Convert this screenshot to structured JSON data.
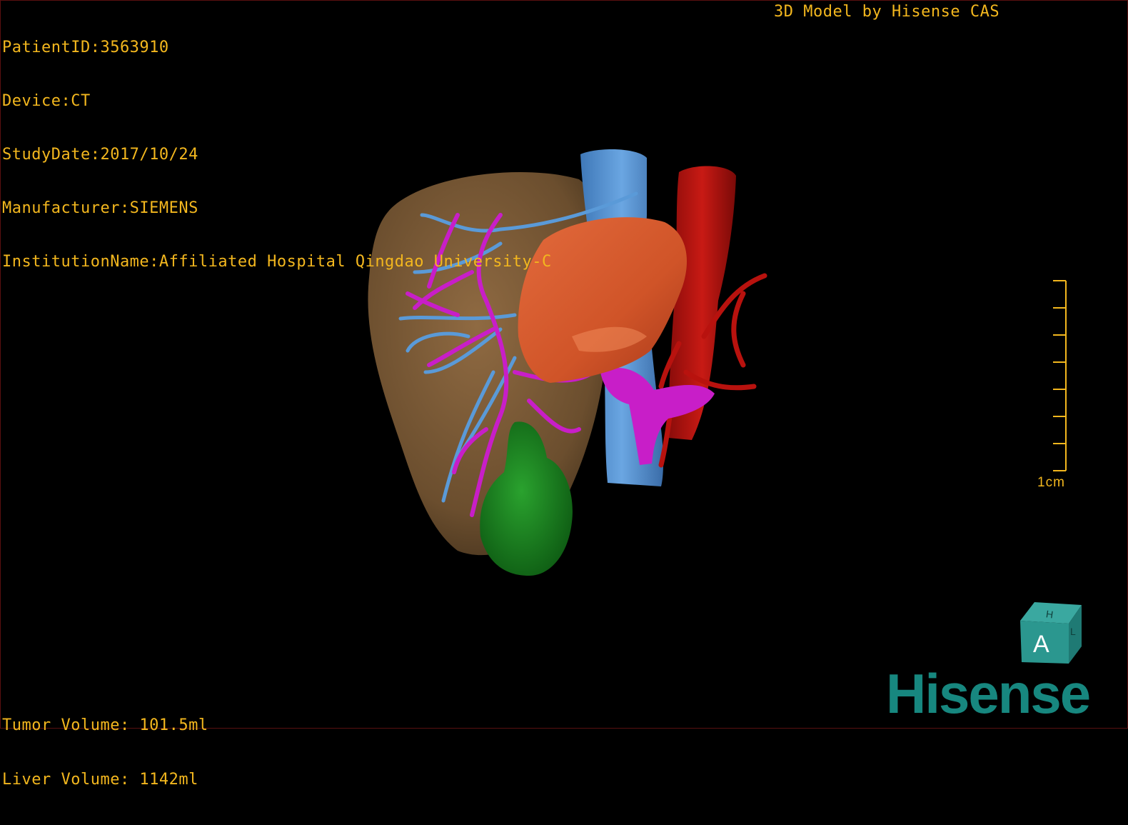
{
  "header": {
    "patient_id": "PatientID:3563910",
    "device": "Device:CT",
    "study_date": "StudyDate:2017/10/24",
    "manufacturer": "Manufacturer:SIEMENS",
    "institution": "InstitutionName:Affiliated Hospital Qingdao University-C"
  },
  "brand_caption": "3D Model by Hisense CAS",
  "volumes": {
    "tumor": "Tumor Volume: 101.5ml",
    "liver": "Liver Volume: 1142ml"
  },
  "scale": {
    "label": "1cm"
  },
  "orientation_cube": {
    "face_front": "A",
    "face_top": "H",
    "face_side": "L",
    "icon": "orientation-cube-icon"
  },
  "logo": {
    "text": "Hisense"
  },
  "colors": {
    "overlay_text": "#f3b71e",
    "liver": "#7a5a36",
    "tumor": "#d8582e",
    "portal_vein": "#c81ec8",
    "hepatic_vein": "#5a9ad8",
    "aorta": "#b8120e",
    "gallbladder": "#1c8a22",
    "logo": "#17877f"
  }
}
